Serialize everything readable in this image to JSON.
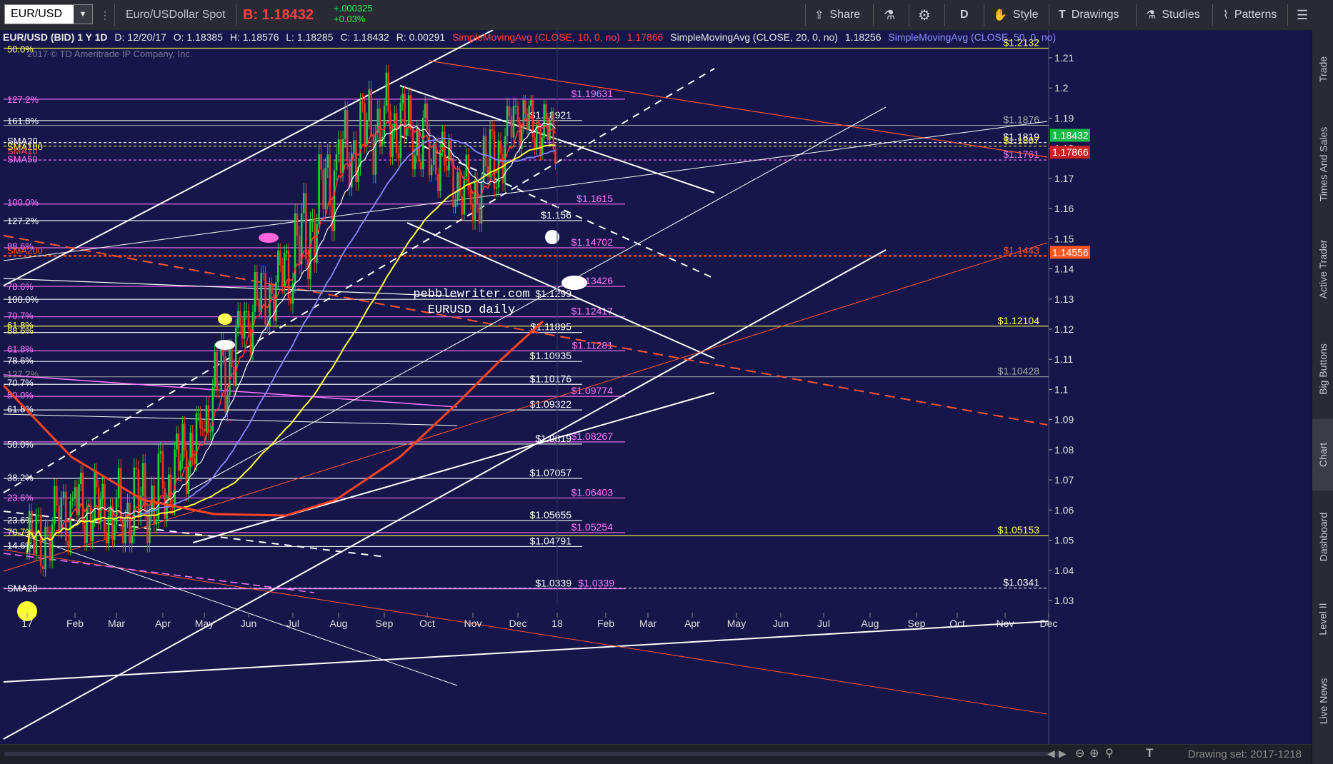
{
  "toolbar": {
    "symbol": "EUR/USD",
    "description": "Euro/USDollar Spot",
    "bid": "B: 1.18432",
    "change_top": "+.000325",
    "change_bottom": "+0.03%",
    "share": "Share",
    "period": "D",
    "style": "Style",
    "drawings": "Drawings",
    "studies": "Studies",
    "patterns": "Patterns"
  },
  "info": {
    "title": "EUR/USD (BID) 1 Y 1D",
    "date": "D: 12/20/17",
    "open": "O: 1.18385",
    "high": "H: 1.18576",
    "low": "L: 1.18285",
    "close": "C: 1.18432",
    "range": "R: 0.00291",
    "sma10": "SimpleMovingAvg (CLOSE, 10, 0, no)",
    "sma10_val": "1.17866",
    "sma20": "SimpleMovingAvg (CLOSE, 20, 0, no)",
    "sma20_val": "1.18256",
    "sma50": "SimpleMovingAvg (CLOSE, 50, 0, no)",
    "copyright": "2017 © TD Ameritrade IP Company, Inc."
  },
  "right_tabs": [
    "Trade",
    "Times And Sales",
    "Active Trader",
    "Big Buttons",
    "Chart",
    "Dashboard",
    "Level II",
    "Live News"
  ],
  "bottom": {
    "drawing_set": "Drawing set: 2017-1218"
  },
  "colors": {
    "background": "#16164a",
    "candle_up": "#22cc44",
    "candle_down": "#ee3322",
    "sma10": "#ff3a3a",
    "sma20": "#ffffff",
    "sma50": "#8888ff",
    "sma100": "#ffff33",
    "sma200": "#ff4422",
    "fib_pink": "#ff77ff",
    "level_yellow": "#ffff55",
    "ellipse_pink": "#ff66dd"
  },
  "chart_data": {
    "type": "candlestick",
    "title": "EUR/USD (BID) 1 Y 1D",
    "watermark": [
      "pebblewriter.com",
      "EURUSD daily"
    ],
    "x_ticks": [
      "17",
      "Feb",
      "Mar",
      "Apr",
      "May",
      "Jun",
      "Jul",
      "Aug",
      "Sep",
      "Oct",
      "Nov",
      "Dec",
      "18",
      "Feb",
      "Mar",
      "Apr",
      "May",
      "Jun",
      "Jul",
      "Aug",
      "Sep",
      "Oct",
      "Nov",
      "Dec"
    ],
    "y_ticks": [
      1.21,
      1.2,
      1.19,
      1.18,
      1.17,
      1.16,
      1.15,
      1.14,
      1.13,
      1.12,
      1.11,
      1.1,
      1.09,
      1.08,
      1.07,
      1.06,
      1.05,
      1.04,
      1.03
    ],
    "ylim": [
      1.025,
      1.215
    ],
    "grid": false,
    "last_price": 1.18432,
    "price_labels": [
      {
        "text": "1.18432",
        "value": 1.1843,
        "color": "#1bb84a"
      },
      {
        "text": "1.17866",
        "value": 1.1787,
        "color": "#cc2222"
      },
      {
        "text": "1.14556",
        "value": 1.1455,
        "color": "#ff5522"
      }
    ],
    "monthly_ohlc": [
      {
        "month": "Jan 17",
        "open": 1.046,
        "high": 1.068,
        "low": 1.034,
        "close": 1.062
      },
      {
        "month": "Feb",
        "open": 1.062,
        "high": 1.083,
        "low": 1.049,
        "close": 1.058
      },
      {
        "month": "Mar",
        "open": 1.058,
        "high": 1.091,
        "low": 1.049,
        "close": 1.065
      },
      {
        "month": "Apr",
        "open": 1.065,
        "high": 1.092,
        "low": 1.057,
        "close": 1.089
      },
      {
        "month": "May",
        "open": 1.089,
        "high": 1.126,
        "low": 1.086,
        "close": 1.124
      },
      {
        "month": "Jun",
        "open": 1.124,
        "high": 1.146,
        "low": 1.112,
        "close": 1.141
      },
      {
        "month": "Jul",
        "open": 1.141,
        "high": 1.178,
        "low": 1.131,
        "close": 1.175
      },
      {
        "month": "Aug",
        "open": 1.175,
        "high": 1.207,
        "low": 1.167,
        "close": 1.191
      },
      {
        "month": "Sep",
        "open": 1.191,
        "high": 1.209,
        "low": 1.173,
        "close": 1.181
      },
      {
        "month": "Oct",
        "open": 1.181,
        "high": 1.188,
        "low": 1.158,
        "close": 1.164
      },
      {
        "month": "Nov",
        "open": 1.164,
        "high": 1.194,
        "low": 1.155,
        "close": 1.19
      },
      {
        "month": "Dec",
        "open": 1.19,
        "high": 1.196,
        "low": 1.172,
        "close": 1.184
      }
    ],
    "horizontal_levels": [
      {
        "value": 1.2132,
        "label": "1.2132",
        "color": "#ffff55",
        "side": "right"
      },
      {
        "value": 1.1963,
        "label": "1.19631",
        "color": "#ff77ff",
        "side": "mid"
      },
      {
        "value": 1.1892,
        "label": "1.18921",
        "color": "#ffffff",
        "side": "mid"
      },
      {
        "value": 1.1876,
        "label": "1.1876",
        "color": "#aaaaaa",
        "side": "right"
      },
      {
        "value": 1.1819,
        "label": "1.1819",
        "color": "#ffffff",
        "side": "right"
      },
      {
        "value": 1.1807,
        "label": "1.1807",
        "color": "#ffff55",
        "side": "right"
      },
      {
        "value": 1.1761,
        "label": "1.1761",
        "color": "#ff77ff",
        "side": "right"
      },
      {
        "value": 1.1615,
        "label": "1.1615",
        "color": "#ff77ff",
        "side": "mid"
      },
      {
        "value": 1.156,
        "label": "1.156",
        "color": "#ffffff",
        "side": "mid"
      },
      {
        "value": 1.147,
        "label": "1.14702",
        "color": "#ff77ff",
        "side": "mid"
      },
      {
        "value": 1.1443,
        "label": "1.1443",
        "color": "#ff5522",
        "side": "right"
      },
      {
        "value": 1.1342,
        "label": "1.13426",
        "color": "#ff77ff",
        "side": "mid"
      },
      {
        "value": 1.1299,
        "label": "1.1299",
        "color": "#ffffff",
        "side": "mid"
      },
      {
        "value": 1.1241,
        "label": "1.12417",
        "color": "#ff77ff",
        "side": "mid"
      },
      {
        "value": 1.121,
        "label": "1.12104",
        "color": "#ffff55",
        "side": "right"
      },
      {
        "value": 1.1189,
        "label": "1.11895",
        "color": "#ffffff",
        "side": "mid"
      },
      {
        "value": 1.1128,
        "label": "1.11281",
        "color": "#ff77ff",
        "side": "mid"
      },
      {
        "value": 1.1093,
        "label": "1.10935",
        "color": "#ffffff",
        "side": "mid"
      },
      {
        "value": 1.1042,
        "label": "1.10428",
        "color": "#aaaaaa",
        "side": "right"
      },
      {
        "value": 1.1017,
        "label": "1.10176",
        "color": "#ffffff",
        "side": "mid"
      },
      {
        "value": 1.0977,
        "label": "1.09774",
        "color": "#ff77ff",
        "side": "mid"
      },
      {
        "value": 1.0932,
        "label": "1.09322",
        "color": "#ffffff",
        "side": "mid"
      },
      {
        "value": 1.0826,
        "label": "1.08267",
        "color": "#ff77ff",
        "side": "mid"
      },
      {
        "value": 1.0819,
        "label": "1.0819",
        "color": "#ffffff",
        "side": "mid"
      },
      {
        "value": 1.0705,
        "label": "1.07057",
        "color": "#ffffff",
        "side": "mid"
      },
      {
        "value": 1.064,
        "label": "1.06403",
        "color": "#ff77ff",
        "side": "mid"
      },
      {
        "value": 1.0565,
        "label": "1.05655",
        "color": "#ffffff",
        "side": "mid"
      },
      {
        "value": 1.0525,
        "label": "1.05254",
        "color": "#ff77ff",
        "side": "mid"
      },
      {
        "value": 1.0515,
        "label": "1.05153",
        "color": "#ffff55",
        "side": "right"
      },
      {
        "value": 1.0479,
        "label": "1.04791",
        "color": "#ffffff",
        "side": "mid"
      },
      {
        "value": 1.0341,
        "label": "1.0341",
        "color": "#ffffff",
        "side": "right"
      },
      {
        "value": 1.0339,
        "label": "1.0339",
        "color": "#ffffff",
        "side": "mid"
      },
      {
        "value": 1.0339,
        "label": "1.0339",
        "color": "#ff77ff",
        "side": "mid2"
      }
    ],
    "left_fib_labels": [
      {
        "text": "50.0%",
        "value": 1.213,
        "color": "#ffff55"
      },
      {
        "text": "127.2%",
        "value": 1.1963,
        "color": "#ff77ff"
      },
      {
        "text": "161.8%",
        "value": 1.1892,
        "color": "#ffffff"
      },
      {
        "text": "SMA20",
        "value": 1.1825,
        "color": "#ffffff"
      },
      {
        "text": "SMA100",
        "value": 1.1806,
        "color": "#ffff55"
      },
      {
        "text": "SMA10",
        "value": 1.1792,
        "color": "#ff5555"
      },
      {
        "text": "SMA50",
        "value": 1.1765,
        "color": "#ff77ff"
      },
      {
        "text": "100.0%",
        "value": 1.1622,
        "color": "#ff77ff"
      },
      {
        "text": "127.2%",
        "value": 1.156,
        "color": "#ffffff"
      },
      {
        "text": "88.6%",
        "value": 1.1476,
        "color": "#ff77ff"
      },
      {
        "text": "SMA200",
        "value": 1.1462,
        "color": "#ff5522"
      },
      {
        "text": "78.6%",
        "value": 1.1342,
        "color": "#ff77ff"
      },
      {
        "text": "100.0%",
        "value": 1.1299,
        "color": "#ffffff"
      },
      {
        "text": "70.7%",
        "value": 1.1246,
        "color": "#ff77ff"
      },
      {
        "text": "61.8%",
        "value": 1.1214,
        "color": "#ffff55"
      },
      {
        "text": "88.6%",
        "value": 1.1196,
        "color": "#ffff55"
      },
      {
        "text": "61.8%",
        "value": 1.1135,
        "color": "#ff77ff"
      },
      {
        "text": "78.6%",
        "value": 1.1097,
        "color": "#ffffff"
      },
      {
        "text": "127.2%",
        "value": 1.1052,
        "color": "#888888"
      },
      {
        "text": "70.7%",
        "value": 1.1023,
        "color": "#ffffff"
      },
      {
        "text": "50.0%",
        "value": 1.0982,
        "color": "#ff77ff"
      },
      {
        "text": "61.8%",
        "value": 1.0936,
        "color": "#ffffff"
      },
      {
        "text": "50.0%",
        "value": 1.0819,
        "color": "#ffffff"
      },
      {
        "text": "38.2%",
        "value": 1.0708,
        "color": "#ffffff"
      },
      {
        "text": "23.6%",
        "value": 1.0642,
        "color": "#ff77ff"
      },
      {
        "text": "23.6%",
        "value": 1.0568,
        "color": "#ffffff"
      },
      {
        "text": "70.7%",
        "value": 1.0528,
        "color": "#ffff55"
      },
      {
        "text": "14.6%",
        "value": 1.0483,
        "color": "#ffffff"
      },
      {
        "text": "SMA20",
        "value": 1.0342,
        "color": "#ffffff"
      }
    ]
  }
}
